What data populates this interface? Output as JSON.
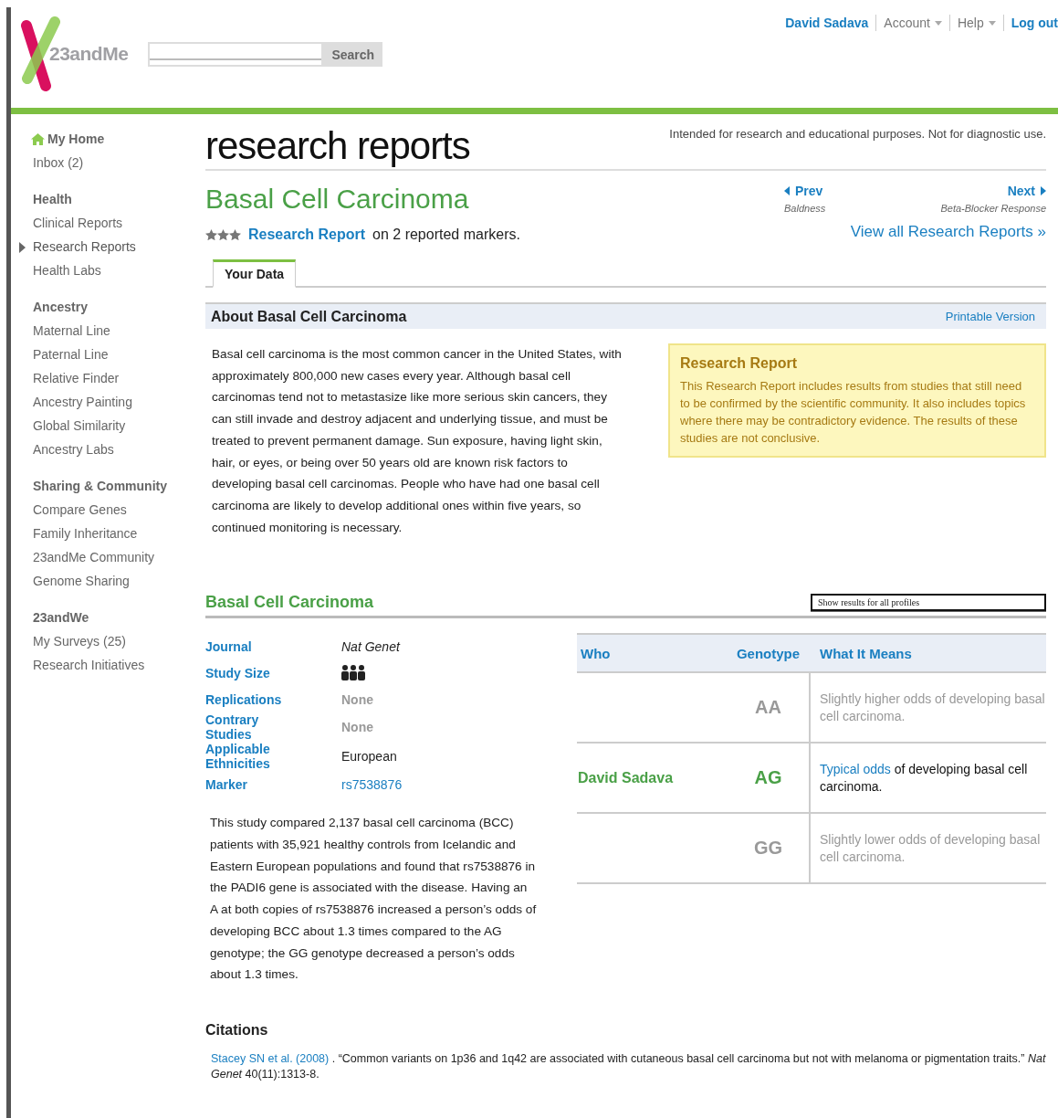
{
  "header": {
    "logo": "23andMe",
    "search_button": "Search",
    "user": "David Sadava",
    "menus": [
      "Account",
      "Help"
    ],
    "logout": "Log out"
  },
  "sidebar": {
    "home": "My Home",
    "inbox": "Inbox (2)",
    "groups": [
      {
        "title": "Health",
        "items": [
          {
            "label": "Clinical Reports",
            "selected": false
          },
          {
            "label": "Research Reports",
            "selected": true
          },
          {
            "label": "Health Labs",
            "selected": false
          }
        ]
      },
      {
        "title": "Ancestry",
        "items": [
          {
            "label": "Maternal Line",
            "selected": false
          },
          {
            "label": "Paternal Line",
            "selected": false
          },
          {
            "label": "Relative Finder",
            "selected": false
          },
          {
            "label": "Ancestry Painting",
            "selected": false
          },
          {
            "label": "Global Similarity",
            "selected": false
          },
          {
            "label": "Ancestry Labs",
            "selected": false
          }
        ]
      },
      {
        "title": "Sharing & Community",
        "items": [
          {
            "label": "Compare Genes",
            "selected": false
          },
          {
            "label": "Family Inheritance",
            "selected": false
          },
          {
            "label": "23andMe Community",
            "selected": false
          },
          {
            "label": "Genome Sharing",
            "selected": false
          }
        ]
      },
      {
        "title": "23andWe",
        "items": [
          {
            "label": "My Surveys (25)",
            "selected": false
          },
          {
            "label": "Research Initiatives",
            "selected": false
          }
        ]
      }
    ]
  },
  "page_title": "research reports",
  "disclaimer": "Intended for research and educational purposes. Not for diagnostic use.",
  "report": {
    "title": "Basal Cell Carcinoma",
    "stars": 3,
    "type_link": "Research Report",
    "type_rest": "on 2 reported markers.",
    "prev": {
      "label": "Prev",
      "topic": "Baldness"
    },
    "next": {
      "label": "Next",
      "topic": "Beta-Blocker Response"
    },
    "view_all": "View all Research Reports »"
  },
  "tabs": [
    {
      "label": "Your Data",
      "selected": true
    }
  ],
  "about": {
    "title": "About Basal Cell Carcinoma",
    "printable": "Printable Version",
    "text": "Basal cell carcinoma is the most common cancer in the United States, with approximately 800,000 new cases every year. Although basal cell carcinomas tend not to metastasize like more serious skin cancers, they can still invade and destroy adjacent and underlying tissue, and must be treated to prevent permanent damage. Sun exposure, having light skin, hair, or eyes, or being over 50 years old are known risk factors to developing basal cell carcinomas. People who have had one basal cell carcinoma are likely to develop additional ones within five years, so continued monitoring is necessary.",
    "notice_title": "Research Report",
    "notice_text": "This Research Report includes results from studies that still need to be confirmed by the scientific community. It also includes topics where there may be contradictory evidence. The results of these studies are not conclusive."
  },
  "study": {
    "title": "Basal Cell Carcinoma",
    "profile_select": "Show results for all profiles",
    "details": [
      {
        "label": "Journal",
        "kind": "italic",
        "value": "Nat Genet"
      },
      {
        "label": "Study Size",
        "kind": "icon"
      },
      {
        "label": "Replications",
        "kind": "muted",
        "value": "None"
      },
      {
        "label": "Contrary Studies",
        "kind": "muted",
        "value": "None"
      },
      {
        "label": "Applicable Ethnicities",
        "kind": "text",
        "value": "European"
      },
      {
        "label": "Marker",
        "kind": "link",
        "value": "rs7538876"
      }
    ],
    "summary": "This study compared 2,137 basal cell carcinoma (BCC) patients with 35,921 healthy controls from Icelandic and Eastern European populations and found that rs7538876 in the PADI6 gene is associated with the disease. Having an A at both copies of rs7538876 increased a person’s odds of developing BCC about 1.3 times compared to the AG genotype; the GG genotype decreased a person’s odds about 1.3 times.",
    "columns": [
      "Who",
      "Genotype",
      "What It Means"
    ],
    "rows": [
      {
        "genotype": "AA",
        "meaning": "Slightly higher odds of developing basal cell carcinoma.",
        "current": false
      },
      {
        "who": "David Sadava",
        "genotype": "AG",
        "meaning_link": "Typical odds",
        "meaning": "of developing basal cell carcinoma.",
        "current": true
      },
      {
        "genotype": "GG",
        "meaning": "Slightly lower odds of developing basal cell carcinoma.",
        "current": false
      }
    ]
  },
  "citations": {
    "title": "Citations",
    "items": [
      {
        "link": "Stacey SN et al. (2008)",
        "text": ". “Common variants on 1p36 and 1q42 are associated with cutaneous basal cell carcinoma but not with melanoma or pigmentation traits.” *Nat Genet* 40(11):1313-8."
      }
    ]
  }
}
